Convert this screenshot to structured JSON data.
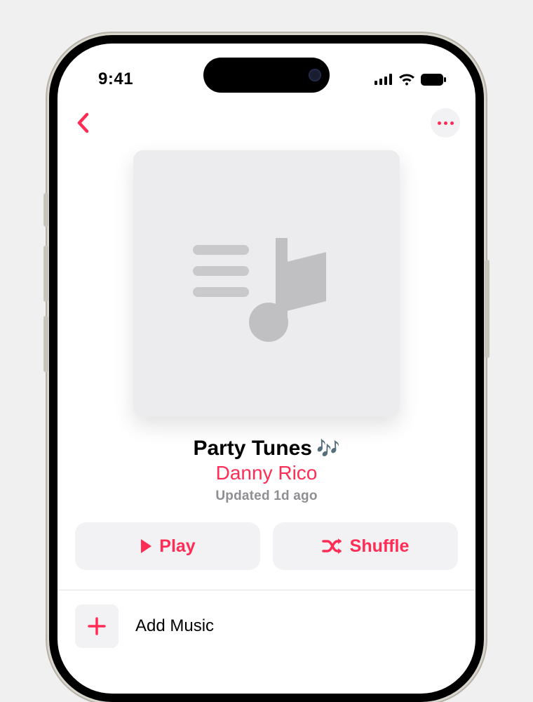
{
  "statusBar": {
    "time": "9:41"
  },
  "playlist": {
    "title": "Party Tunes",
    "emoji": "🎶",
    "author": "Danny Rico",
    "updated": "Updated 1d ago"
  },
  "actions": {
    "play": "Play",
    "shuffle": "Shuffle"
  },
  "addMusic": {
    "label": "Add Music"
  },
  "colors": {
    "accent": "#ff2d55"
  }
}
